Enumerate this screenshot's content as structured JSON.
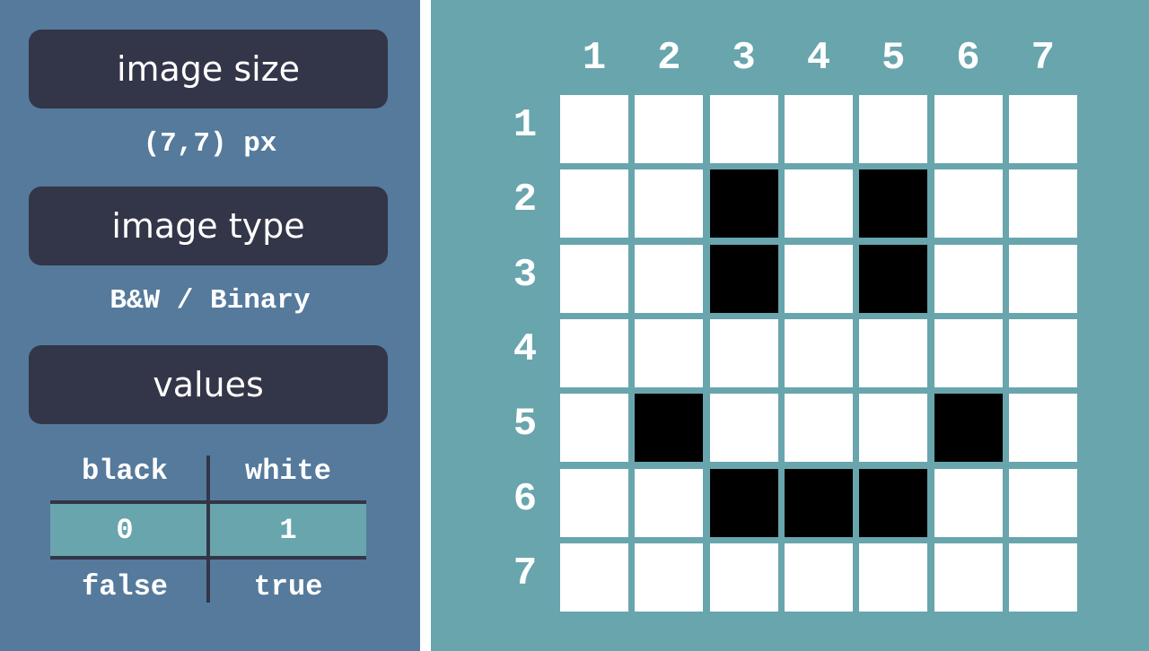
{
  "left": {
    "size_title": "image size",
    "size_value": "(7,7) px",
    "type_title": "image type",
    "type_value": "B&W / Binary",
    "values_title": "values",
    "table": {
      "headers": [
        "black",
        "white"
      ],
      "values": [
        "0",
        "1"
      ],
      "footers": [
        "false",
        "true"
      ]
    }
  },
  "grid": {
    "column_labels": [
      "1",
      "2",
      "3",
      "4",
      "5",
      "6",
      "7"
    ],
    "row_labels": [
      "1",
      "2",
      "3",
      "4",
      "5",
      "6",
      "7"
    ],
    "pixels": [
      [
        1,
        1,
        1,
        1,
        1,
        1,
        1
      ],
      [
        1,
        1,
        0,
        1,
        0,
        1,
        1
      ],
      [
        1,
        1,
        0,
        1,
        0,
        1,
        1
      ],
      [
        1,
        1,
        1,
        1,
        1,
        1,
        1
      ],
      [
        1,
        0,
        1,
        1,
        1,
        0,
        1
      ],
      [
        1,
        1,
        0,
        0,
        0,
        1,
        1
      ],
      [
        1,
        1,
        1,
        1,
        1,
        1,
        1
      ]
    ],
    "colors": {
      "0": "#000000",
      "1": "#ffffff"
    }
  }
}
